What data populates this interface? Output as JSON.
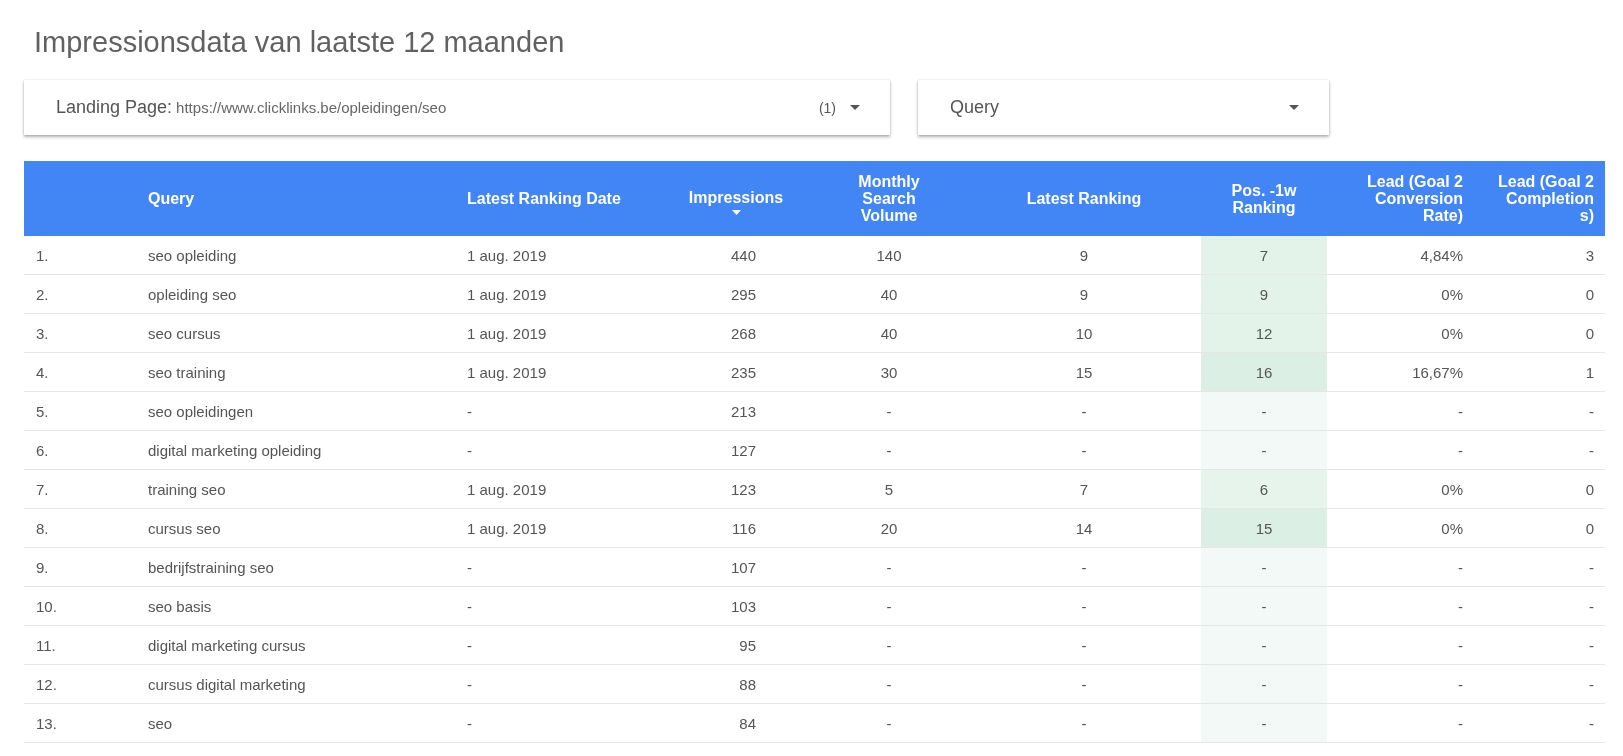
{
  "title": "Impressionsdata van laatste 12 maanden",
  "filters": [
    {
      "kind": "valued",
      "label": "Landing Page:",
      "value": "https://www.clicklinks.be/opleidingen/seo",
      "count": "(1)"
    },
    {
      "kind": "plain",
      "label": "Query"
    }
  ],
  "table": {
    "columns": [
      {
        "label": "Query",
        "sorted": false
      },
      {
        "label": "Latest Ranking Date",
        "sorted": false
      },
      {
        "label": "Impressions",
        "sorted": true
      },
      {
        "label": "Monthly Search Volume",
        "sorted": false
      },
      {
        "label": "Latest Ranking",
        "sorted": false
      },
      {
        "label": "Pos. -1w Ranking",
        "sorted": false
      },
      {
        "label": "Lead (Goal 2 Conversion Rate)",
        "sorted": false
      },
      {
        "label": "Lead (Goal 2 Completions)",
        "sorted": false
      }
    ],
    "rows": [
      {
        "number": "1.",
        "cells": [
          "seo opleiding",
          "1 aug. 2019",
          "440",
          "140",
          "9",
          "7",
          "4,84%",
          "3"
        ],
        "color": "#e3f3ea"
      },
      {
        "number": "2.",
        "cells": [
          "opleiding seo",
          "1 aug. 2019",
          "295",
          "40",
          "9",
          "9",
          "0%",
          "0"
        ],
        "color": "#e3f3ea"
      },
      {
        "number": "3.",
        "cells": [
          "seo cursus",
          "1 aug. 2019",
          "268",
          "40",
          "10",
          "12",
          "0%",
          "0"
        ],
        "color": "#e3f3ea"
      },
      {
        "number": "4.",
        "cells": [
          "seo training",
          "1 aug. 2019",
          "235",
          "30",
          "15",
          "16",
          "16,67%",
          "1"
        ],
        "color": "#dcefe5"
      },
      {
        "number": "5.",
        "cells": [
          "seo opleidingen",
          "-",
          "213",
          "-",
          "-",
          "-",
          "-",
          "-"
        ],
        "color": "#f3f9f6"
      },
      {
        "number": "6.",
        "cells": [
          "digital marketing opleiding",
          "-",
          "127",
          "-",
          "-",
          "-",
          "-",
          "-"
        ],
        "color": "#f3f9f6"
      },
      {
        "number": "7.",
        "cells": [
          "training seo",
          "1 aug. 2019",
          "123",
          "5",
          "7",
          "6",
          "0%",
          "0"
        ],
        "color": "#e6f4ec"
      },
      {
        "number": "8.",
        "cells": [
          "cursus seo",
          "1 aug. 2019",
          "116",
          "20",
          "14",
          "15",
          "0%",
          "0"
        ],
        "color": "#dcefe5"
      },
      {
        "number": "9.",
        "cells": [
          "bedrijfstraining seo",
          "-",
          "107",
          "-",
          "-",
          "-",
          "-",
          "-"
        ],
        "color": "#f3f9f6"
      },
      {
        "number": "10.",
        "cells": [
          "seo basis",
          "-",
          "103",
          "-",
          "-",
          "-",
          "-",
          "-"
        ],
        "color": "#f3f9f6"
      },
      {
        "number": "11.",
        "cells": [
          "digital marketing cursus",
          "-",
          "95",
          "-",
          "-",
          "-",
          "-",
          "-"
        ],
        "color": "#f3f9f6"
      },
      {
        "number": "12.",
        "cells": [
          "cursus digital marketing",
          "-",
          "88",
          "-",
          "-",
          "-",
          "-",
          "-"
        ],
        "color": "#f3f9f6"
      },
      {
        "number": "13.",
        "cells": [
          "seo",
          "-",
          "84",
          "-",
          "-",
          "-",
          "-",
          "-"
        ],
        "color": "#f3f9f6"
      }
    ]
  }
}
